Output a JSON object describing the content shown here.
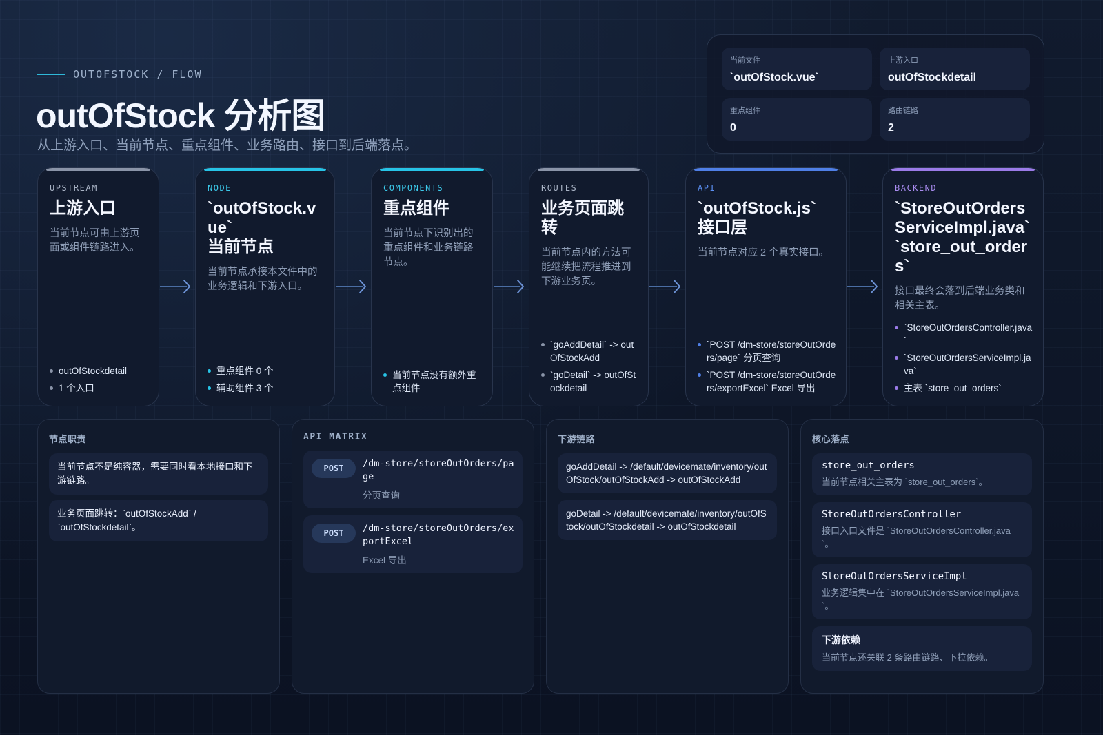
{
  "header": {
    "eyebrow": "OUTOFSTOCK / FLOW",
    "title": "outOfStock 分析图",
    "subtitle": "从上游入口、当前节点、重点组件、业务路由、接口到后端落点。"
  },
  "stats": [
    {
      "label": "当前文件",
      "value": "`outOfStock.vue`"
    },
    {
      "label": "上游入口",
      "value": "outOfStockdetail"
    },
    {
      "label": "重点组件",
      "value": "0"
    },
    {
      "label": "路由链路",
      "value": "2"
    }
  ],
  "flow": [
    {
      "tag": "UPSTREAM",
      "title_lines": [
        "上游入口"
      ],
      "desc": "当前节点可由上游页面或组件链路进入。",
      "bullets": [
        "outOfStockdetail",
        "1 个入口"
      ],
      "accent": "#8a94a8",
      "tag_color": "#aab4c6",
      "dot": "#8a94a8"
    },
    {
      "tag": "NODE",
      "title_lines": [
        "`outOfStock.vue`",
        "当前节点"
      ],
      "desc": "当前节点承接本文件中的业务逻辑和下游入口。",
      "bullets": [
        "重点组件 0 个",
        "辅助组件 3 个"
      ],
      "accent": "#27c3e6",
      "tag_color": "#3cc9ea",
      "dot": "#27c3e6"
    },
    {
      "tag": "COMPONENTS",
      "title_lines": [
        "重点组件"
      ],
      "desc": "当前节点下识别出的重点组件和业务链路节点。",
      "bullets": [
        "当前节点没有额外重点组件"
      ],
      "accent": "#27c3e6",
      "tag_color": "#3cc9ea",
      "dot": "#27c3e6"
    },
    {
      "tag": "ROUTES",
      "title_lines": [
        "业务页面跳转"
      ],
      "desc": "当前节点内的方法可能继续把流程推进到下游业务页。",
      "bullets": [
        "`goAddDetail` -> outOfStockAdd",
        "`goDetail` -> outOfStockdetail"
      ],
      "accent": "#8a94a8",
      "tag_color": "#aab4c6",
      "dot": "#8a94a8"
    },
    {
      "tag": "API",
      "title_lines": [
        "`outOfStock.js`",
        "接口层"
      ],
      "desc": "当前节点对应 2 个真实接口。",
      "bullets": [
        "`POST /dm-store/storeOutOrders/page` 分页查询",
        "`POST /dm-store/storeOutOrders/exportExcel` Excel 导出"
      ],
      "accent": "#4f7fe6",
      "tag_color": "#5b8ff2",
      "dot": "#4f7fe6"
    },
    {
      "tag": "BACKEND",
      "title_lines": [
        "`StoreOutOrdersServiceImpl.java`",
        "`store_out_orders`"
      ],
      "desc": "接口最终会落到后端业务类和相关主表。",
      "bullets": [
        "`StoreOutOrdersController.java`",
        "`StoreOutOrdersServiceImpl.java`",
        "主表 `store_out_orders`"
      ],
      "accent": "#9b7be8",
      "tag_color": "#a98cf0",
      "dot": "#9b7be8"
    }
  ],
  "responsibility": {
    "title": "节点职责",
    "notes": [
      "当前节点不是纯容器，需要同时看本地接口和下游链路。",
      "业务页面跳转：`outOfStockAdd` / `outOfStockdetail`。"
    ]
  },
  "api_matrix": {
    "title": "API MATRIX",
    "rows": [
      {
        "method": "POST",
        "path": "/dm-store/storeOutOrders/page",
        "desc": "分页查询"
      },
      {
        "method": "POST",
        "path": "/dm-store/storeOutOrders/exportExcel",
        "desc": "Excel 导出"
      }
    ]
  },
  "downstream": {
    "title": "下游链路",
    "chains": [
      "goAddDetail -> /default/devicemate/inventory/outOfStock/outOfStockAdd -> outOfStockAdd",
      "goDetail -> /default/devicemate/inventory/outOfStock/outOfStockdetail -> outOfStockdetail"
    ]
  },
  "core": {
    "title": "核心落点",
    "items": [
      {
        "name": "store_out_orders",
        "desc": "当前节点相关主表为 `store_out_orders`。",
        "mono": true
      },
      {
        "name": "StoreOutOrdersController",
        "desc": "接口入口文件是 `StoreOutOrdersController.java`。",
        "mono": true
      },
      {
        "name": "StoreOutOrdersServiceImpl",
        "desc": "业务逻辑集中在 `StoreOutOrdersServiceImpl.java`。",
        "mono": true
      },
      {
        "name": "下游依赖",
        "desc": "当前节点还关联 2 条路由链路、下拉依赖。",
        "mono": false
      }
    ]
  }
}
